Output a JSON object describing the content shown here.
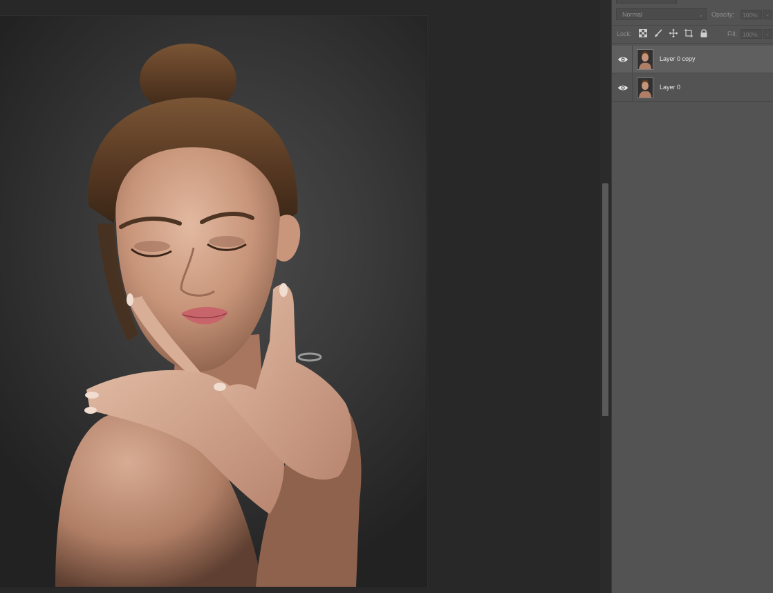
{
  "layers_panel": {
    "blend_mode": "Normal",
    "opacity_label": "Opacity:",
    "opacity_value": "100%",
    "lock_label": "Lock:",
    "fill_label": "Fill:",
    "fill_value": "100%",
    "layers": [
      {
        "name": "Layer 0 copy",
        "visible": true,
        "selected": true
      },
      {
        "name": "Layer 0",
        "visible": true,
        "selected": false
      }
    ]
  },
  "canvas": {
    "image_subject": "portrait of a woman with hair in a bun, hands crossed near face, dark studio background"
  },
  "colors": {
    "workspace_bg": "#282828",
    "panel_bg": "#535353",
    "selected_layer_bg": "#5f5f5f",
    "text": "#e6e6e6"
  },
  "icons": {
    "layer_visibility": "eye-icon",
    "lock_transparent": "lock-transparent-pixels-icon",
    "lock_image": "brush-icon",
    "lock_position": "move-icon",
    "lock_artboard": "artboard-icon",
    "lock_all": "lock-icon"
  }
}
